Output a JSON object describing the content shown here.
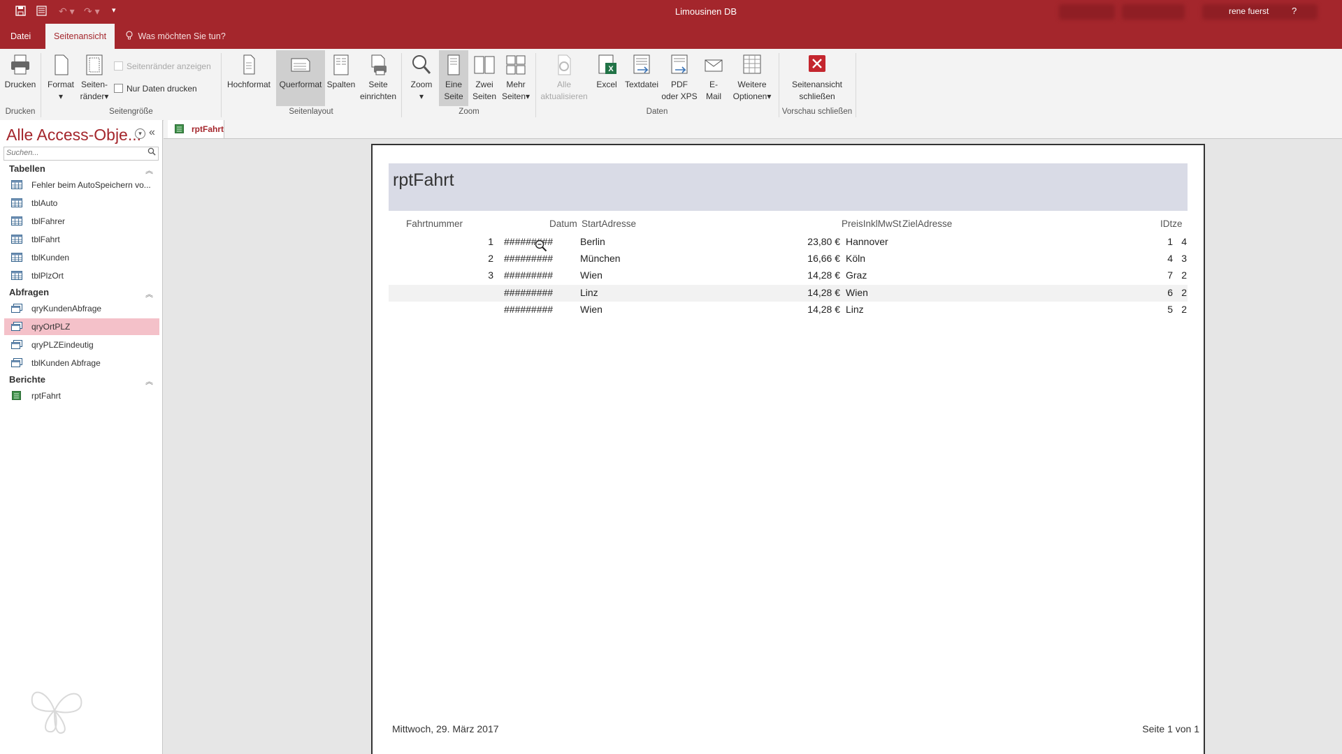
{
  "app": {
    "title": "Limousinen DB",
    "user": "rene fuerst",
    "help": "?"
  },
  "tabs": {
    "file": "Datei",
    "active": "Seitenansicht",
    "tell_me": "Was möchten Sie tun?"
  },
  "ribbon": {
    "drucken": "Drucken",
    "format": "Format",
    "seitenraender_1": "Seiten-",
    "seitenraender_2": "ränder",
    "seitenraender_anzeigen": "Seitenränder anzeigen",
    "nur_daten_drucken": "Nur Daten drucken",
    "hochformat": "Hochformat",
    "querformat": "Querformat",
    "spalten": "Spalten",
    "seite_1": "Seite",
    "seite_2": "einrichten",
    "zoom": "Zoom",
    "eine_1": "Eine",
    "eine_2": "Seite",
    "zwei_1": "Zwei",
    "zwei_2": "Seiten",
    "mehr_1": "Mehr",
    "mehr_2": "Seiten",
    "alle_1": "Alle",
    "alle_2": "aktualisieren",
    "excel": "Excel",
    "textdatei": "Textdatei",
    "pdf_1": "PDF",
    "pdf_2": "oder XPS",
    "email_1": "E-",
    "email_2": "Mail",
    "weitere_1": "Weitere",
    "weitere_2": "Optionen",
    "schliessen_1": "Seitenansicht",
    "schliessen_2": "schließen",
    "groups": {
      "drucken": "Drucken",
      "seitengroesse": "Seitengröße",
      "seitenlayout": "Seitenlayout",
      "zoom": "Zoom",
      "daten": "Daten",
      "vorschau": "Vorschau schließen"
    }
  },
  "nav": {
    "title": "Alle Access-Obje...",
    "search_placeholder": "Suchen...",
    "sections": {
      "tabellen": "Tabellen",
      "abfragen": "Abfragen",
      "berichte": "Berichte"
    },
    "tables": [
      "Fehler beim AutoSpeichern vo...",
      "tblAuto",
      "tblFahrer",
      "tblFahrt",
      "tblKunden",
      "tblPlzOrt"
    ],
    "queries": [
      "qryKundenAbfrage",
      "qryOrtPLZ",
      "qryPLZEindeutig",
      "tblKunden Abfrage"
    ],
    "reports": [
      "rptFahrt"
    ]
  },
  "doc_tab": "rptFahrt",
  "report": {
    "title": "rptFahrt",
    "headers": {
      "fahrtnummer": "Fahrtnummer",
      "datum": "Datum",
      "start": "StartAdresse",
      "preis": "PreisInklMwSt",
      "ziel": "ZielAdresse",
      "id": "IDtze"
    },
    "rows": [
      {
        "nr": "1",
        "datum": "#########",
        "start": "Berlin",
        "preis": "23,80 €",
        "ziel": "Hannover",
        "a": "1",
        "b": "4"
      },
      {
        "nr": "2",
        "datum": "#########",
        "start": "München",
        "preis": "16,66 €",
        "ziel": "Köln",
        "a": "4",
        "b": "3"
      },
      {
        "nr": "3",
        "datum": "#########",
        "start": "Wien",
        "preis": "14,28 €",
        "ziel": "Graz",
        "a": "7",
        "b": "2"
      },
      {
        "nr": "",
        "datum": "#########",
        "start": "Linz",
        "preis": "14,28 €",
        "ziel": "Wien",
        "a": "6",
        "b": "2"
      },
      {
        "nr": "",
        "datum": "#########",
        "start": "Wien",
        "preis": "14,28 €",
        "ziel": "Linz",
        "a": "5",
        "b": "2"
      }
    ],
    "footer_date": "Mittwoch, 29. März 2017",
    "footer_page": "Seite 1 von 1"
  }
}
